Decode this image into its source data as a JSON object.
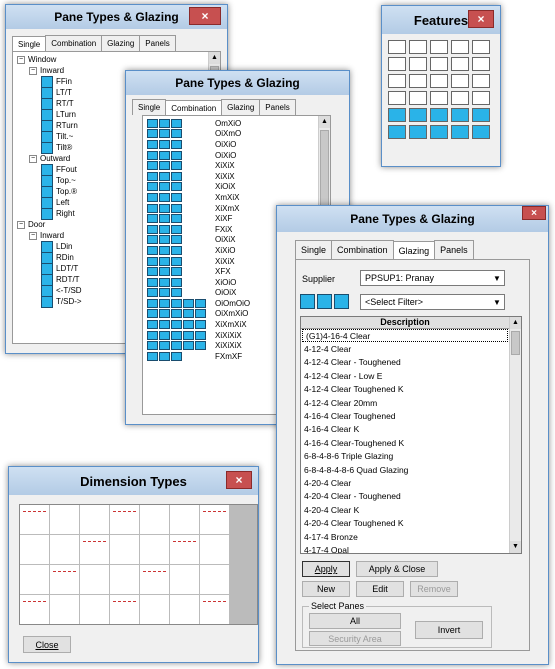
{
  "win1": {
    "title": "Pane Types & Glazing",
    "tabs": [
      "Single",
      "Combination",
      "Glazing",
      "Panels"
    ],
    "tree": [
      {
        "level": 0,
        "pm": "−",
        "label": "Window"
      },
      {
        "level": 1,
        "pm": "−",
        "label": "Inward"
      },
      {
        "level": 2,
        "label": "FFin"
      },
      {
        "level": 2,
        "label": "LT/T"
      },
      {
        "level": 2,
        "label": "RT/T"
      },
      {
        "level": 2,
        "label": "LTurn"
      },
      {
        "level": 2,
        "label": "RTurn"
      },
      {
        "level": 2,
        "label": "Tilt.~"
      },
      {
        "level": 2,
        "label": "Tilt®"
      },
      {
        "level": 1,
        "pm": "−",
        "label": "Outward"
      },
      {
        "level": 2,
        "label": "FFout"
      },
      {
        "level": 2,
        "label": "Top.~"
      },
      {
        "level": 2,
        "label": "Top.®"
      },
      {
        "level": 2,
        "label": "Left"
      },
      {
        "level": 2,
        "label": "Right"
      },
      {
        "level": 0,
        "pm": "−",
        "label": "Door"
      },
      {
        "level": 1,
        "pm": "−",
        "label": "Inward"
      },
      {
        "level": 2,
        "label": "LDin"
      },
      {
        "level": 2,
        "label": "RDin"
      },
      {
        "level": 2,
        "label": "LDT/T"
      },
      {
        "level": 2,
        "label": "RDT/T"
      },
      {
        "level": 2,
        "label": "<-T/SD"
      },
      {
        "level": 2,
        "label": "T/SD->"
      }
    ]
  },
  "win2": {
    "title": "Pane Types & Glazing",
    "tabs": [
      "Single",
      "Combination",
      "Glazing",
      "Panels"
    ],
    "combos": [
      "OmXiO",
      "OiXmO",
      "OiXiO",
      "OiXiO",
      "XiXiX",
      "XiXiX",
      "XiOiX",
      "XmXiX",
      "XiXmX",
      "XiXF",
      "FXiX",
      "OiXiX",
      "XiXiO",
      "XiXiX",
      "XFX",
      "XiOiO",
      "OiOiX",
      "OiOmOiO",
      "OiXmXiO",
      "XiXmXiX",
      "XiXiXiX",
      "XiXiXiX",
      "FXmXF"
    ]
  },
  "features": {
    "title": "Features"
  },
  "win3": {
    "title": "Pane Types & Glazing",
    "tabs": [
      "Single",
      "Combination",
      "Glazing",
      "Panels"
    ],
    "supplier_label": "Supplier",
    "supplier_value": "PPSUP1: Pranay",
    "filter_value": "<Select Filter>",
    "list_header": "Description",
    "items": [
      "(G1)4-16-4 Clear",
      "4-12-4 Clear",
      "4-12-4 Clear - Toughened",
      "4-12-4 Clear - Low E",
      "4-12-4 Clear Toughened K",
      "4-12-4 Clear 20mm",
      "4-16-4 Clear Toughened",
      "4-16-4 Clear K",
      "4-16-4 Clear-Toughened K",
      "6-8-4-8-6 Triple Glazing",
      "6-8-4-8-4-8-6 Quad Glazing",
      "4-20-4 Clear",
      "4-20-4 Clear - Toughened",
      "4-20-4 Clear K",
      "4-20-4 Clear Toughened K",
      "4-17-4 Bronze",
      "4-17-4 Opal"
    ],
    "btn_apply": "Apply",
    "btn_apply_close": "Apply & Close",
    "btn_new": "New",
    "btn_edit": "Edit",
    "btn_remove": "Remove",
    "select_panes_label": "Select Panes",
    "btn_all": "All",
    "btn_invert": "Invert",
    "btn_security": "Security Area"
  },
  "dimension": {
    "title": "Dimension Types",
    "btn_close": "Close"
  },
  "close_glyph": "×",
  "colors": {
    "pane_blue": "#2ab3e8",
    "close_red": "#c75050",
    "title_bg": "#b9d1ea"
  }
}
